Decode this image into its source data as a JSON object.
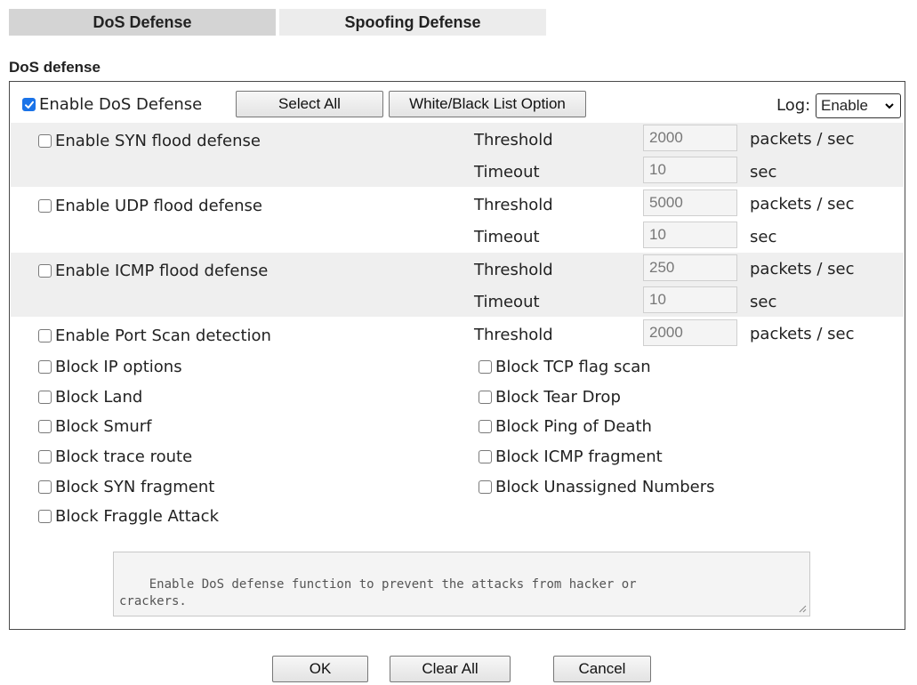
{
  "tabs": [
    {
      "label": "DoS Defense",
      "active": true
    },
    {
      "label": "Spoofing Defense",
      "active": false
    }
  ],
  "section_title": "DoS defense",
  "header": {
    "enable_label": "Enable DoS Defense",
    "enable_checked": true,
    "select_all_label": "Select All",
    "list_option_label": "White/Black List Option",
    "log_label": "Log:",
    "log_value": "Enable"
  },
  "floods": [
    {
      "label": "Enable SYN flood defense",
      "threshold_label": "Threshold",
      "threshold": "2000",
      "threshold_unit": "packets / sec",
      "timeout_label": "Timeout",
      "timeout": "10",
      "timeout_unit": "sec"
    },
    {
      "label": "Enable UDP flood defense",
      "threshold_label": "Threshold",
      "threshold": "5000",
      "threshold_unit": "packets / sec",
      "timeout_label": "Timeout",
      "timeout": "10",
      "timeout_unit": "sec"
    },
    {
      "label": "Enable ICMP flood defense",
      "threshold_label": "Threshold",
      "threshold": "250",
      "threshold_unit": "packets / sec",
      "timeout_label": "Timeout",
      "timeout": "10",
      "timeout_unit": "sec"
    }
  ],
  "port_scan": {
    "label": "Enable Port Scan detection",
    "threshold_label": "Threshold",
    "threshold": "2000",
    "threshold_unit": "packets / sec"
  },
  "blocks_left": [
    "Block IP options",
    "Block Land",
    "Block Smurf",
    "Block trace route",
    "Block SYN fragment",
    "Block Fraggle Attack"
  ],
  "blocks_right": [
    "Block TCP flag scan",
    "Block Tear Drop",
    "Block Ping of Death",
    "Block ICMP fragment",
    "Block Unassigned Numbers"
  ],
  "description": "Enable DoS defense function to prevent the attacks from hacker or\ncrackers.",
  "buttons": {
    "ok": "OK",
    "clear_all": "Clear All",
    "cancel": "Cancel"
  },
  "colors": {
    "checkbox_checked": "#1a73e8",
    "band": "#efefef"
  }
}
